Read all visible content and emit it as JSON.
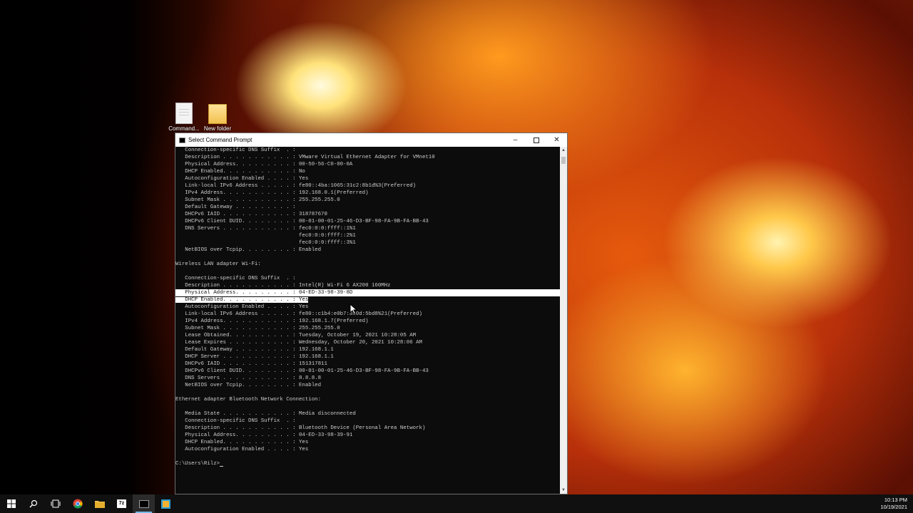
{
  "desktop": {
    "icons": [
      {
        "label": "Command...",
        "icon": "document-icon"
      },
      {
        "label": "New folder",
        "icon": "folder-icon"
      }
    ]
  },
  "window": {
    "title": "Select Command Prompt",
    "controls": {
      "minimize": "–",
      "maximize": "□",
      "close": "✕"
    },
    "lines": [
      "   Connection-specific DNS Suffix  . :",
      "   Description . . . . . . . . . . . : VMware Virtual Ethernet Adapter for VMnet10",
      "   Physical Address. . . . . . . . . : 00-50-56-C0-00-0A",
      "   DHCP Enabled. . . . . . . . . . . : No",
      "   Autoconfiguration Enabled . . . . : Yes",
      "   Link-local IPv6 Address . . . . . : fe80::4ba:1065:31c2:8b1d%3(Preferred)",
      "   IPv4 Address. . . . . . . . . . . : 192.168.0.1(Preferred)",
      "   Subnet Mask . . . . . . . . . . . : 255.255.255.0",
      "   Default Gateway . . . . . . . . . :",
      "   DHCPv6 IAID . . . . . . . . . . . : 318787670",
      "   DHCPv6 Client DUID. . . . . . . . : 00-01-00-01-25-46-D3-BF-98-FA-9B-FA-BB-43",
      "   DNS Servers . . . . . . . . . . . : fec0:0:0:ffff::1%1",
      "                                       fec0:0:0:ffff::2%1",
      "                                       fec0:0:0:ffff::3%1",
      "   NetBIOS over Tcpip. . . . . . . . : Enabled",
      "",
      "Wireless LAN adapter Wi-Fi:",
      "",
      "   Connection-specific DNS Suffix  . :",
      "   Description . . . . . . . . . . . : Intel(R) Wi-Fi 6 AX200 160MHz",
      "   Physical Address. . . . . . . . . : 04-ED-33-98-39-8D",
      "   DHCP Enabled. . . . . . . . . . . : Yes",
      "   Autoconfiguration Enabled . . . . : Yes",
      "   Link-local IPv6 Address . . . . . : fe80::c1b4:e0b7:860d:5bd8%21(Preferred)",
      "   IPv4 Address. . . . . . . . . . . : 192.168.1.7(Preferred)",
      "   Subnet Mask . . . . . . . . . . . : 255.255.255.0",
      "   Lease Obtained. . . . . . . . . . : Tuesday, October 19, 2021 10:28:05 AM",
      "   Lease Expires . . . . . . . . . . : Wednesday, October 20, 2021 10:28:06 AM",
      "   Default Gateway . . . . . . . . . : 192.168.1.1",
      "   DHCP Server . . . . . . . . . . . : 192.168.1.1",
      "   DHCPv6 IAID . . . . . . . . . . . : 151317811",
      "   DHCPv6 Client DUID. . . . . . . . : 00-01-00-01-25-46-D3-BF-98-FA-9B-FA-BB-43",
      "   DNS Servers . . . . . . . . . . . : 8.8.8.8",
      "   NetBIOS over Tcpip. . . . . . . . : Enabled",
      "",
      "Ethernet adapter Bluetooth Network Connection:",
      "",
      "   Media State . . . . . . . . . . . : Media disconnected",
      "   Connection-specific DNS Suffix  . :",
      "   Description . . . . . . . . . . . : Bluetooth Device (Personal Area Network)",
      "   Physical Address. . . . . . . . . : 04-ED-33-98-39-91",
      "   DHCP Enabled. . . . . . . . . . . : Yes",
      "   Autoconfiguration Enabled . . . . : Yes",
      "",
      "C:\\Users\\Rilz>"
    ],
    "selection_line": 20,
    "selection_partial_line": 21
  },
  "taskbar": {
    "items": [
      {
        "icon": "windows-start-icon",
        "active": false
      },
      {
        "icon": "search-icon",
        "active": false
      },
      {
        "icon": "task-view-icon",
        "active": false
      },
      {
        "icon": "chrome-icon",
        "active": false
      },
      {
        "icon": "file-explorer-icon",
        "active": false
      },
      {
        "icon": "7zip-icon",
        "active": false
      },
      {
        "icon": "command-prompt-icon",
        "active": true
      },
      {
        "icon": "app-icon",
        "active": false
      }
    ],
    "clock": {
      "time": "10:13 PM",
      "date": "10/19/2021"
    }
  }
}
